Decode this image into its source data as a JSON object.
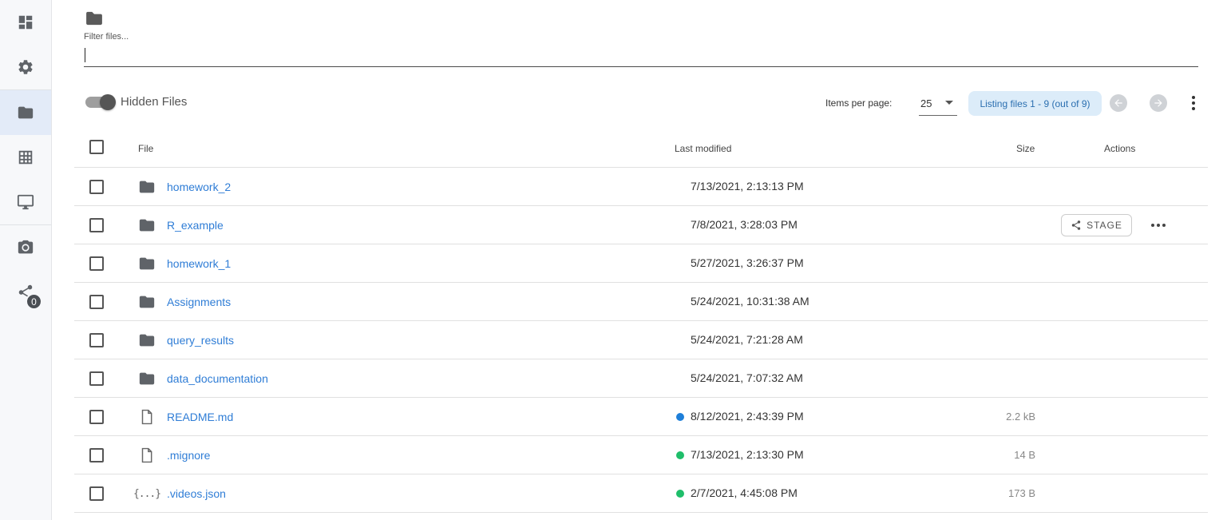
{
  "sidebar": {
    "items": [
      {
        "icon": "dashboard-icon"
      },
      {
        "icon": "gear-icon"
      },
      {
        "icon": "folder-icon",
        "active": true
      },
      {
        "icon": "table-icon"
      },
      {
        "icon": "monitor-icon"
      },
      {
        "icon": "camera-icon"
      },
      {
        "icon": "share-icon",
        "badge": "0"
      }
    ]
  },
  "filter": {
    "label": "Filter files...",
    "value": ""
  },
  "toolbar": {
    "hidden_files_label": "Hidden Files",
    "hidden_files_on": true,
    "items_per_page_label": "Items per page:",
    "items_per_page_value": "25",
    "listing_text": "Listing files 1 - 9 (out of 9)"
  },
  "table": {
    "headers": {
      "file": "File",
      "modified": "Last modified",
      "size": "Size",
      "actions": "Actions"
    },
    "rows": [
      {
        "type": "folder",
        "name": "homework_2",
        "modified": "7/13/2021, 2:13:13 PM",
        "size": "",
        "status": ""
      },
      {
        "type": "folder",
        "name": "R_example",
        "modified": "7/8/2021, 3:28:03 PM",
        "size": "",
        "status": "",
        "stage_label": "STAGE"
      },
      {
        "type": "folder",
        "name": "homework_1",
        "modified": "5/27/2021, 3:26:37 PM",
        "size": "",
        "status": ""
      },
      {
        "type": "folder",
        "name": "Assignments",
        "modified": "5/24/2021, 10:31:38 AM",
        "size": "",
        "status": ""
      },
      {
        "type": "folder",
        "name": "query_results",
        "modified": "5/24/2021, 7:21:28 AM",
        "size": "",
        "status": ""
      },
      {
        "type": "folder",
        "name": "data_documentation",
        "modified": "5/24/2021, 7:07:32 AM",
        "size": "",
        "status": ""
      },
      {
        "type": "file",
        "name": "README.md",
        "modified": "8/12/2021, 2:43:39 PM",
        "size": "2.2 kB",
        "status": "#1e7fd9"
      },
      {
        "type": "file",
        "name": ".mignore",
        "modified": "7/13/2021, 2:13:30 PM",
        "size": "14 B",
        "status": "#1fbe6a"
      },
      {
        "type": "json",
        "name": ".videos.json",
        "modified": "2/7/2021, 4:45:08 PM",
        "size": "173 B",
        "status": "#1fbe6a",
        "icon_text": "{...}"
      }
    ]
  }
}
